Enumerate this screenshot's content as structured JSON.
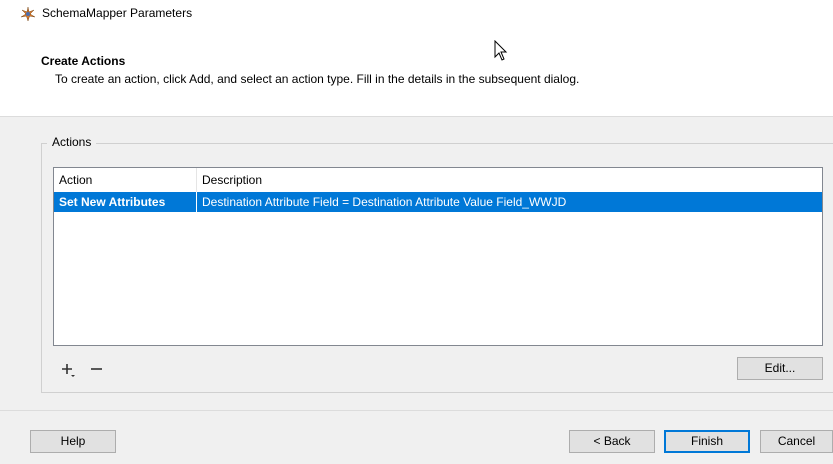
{
  "window": {
    "title": "SchemaMapper Parameters",
    "icon": "schemamapper-icon"
  },
  "header": {
    "title": "Create Actions",
    "description": "To create an action, click Add, and select an action type. Fill in the details in the subsequent dialog."
  },
  "group": {
    "label": "Actions"
  },
  "table": {
    "columns": [
      "Action",
      "Description"
    ],
    "rows": [
      {
        "action": "Set New Attributes",
        "description": "Destination Attribute Field = Destination Attribute Value Field_WWJD",
        "selected": true
      }
    ]
  },
  "toolbar": {
    "add_icon": "plus-dropdown-icon",
    "remove_icon": "minus-icon",
    "edit_label": "Edit..."
  },
  "footer": {
    "help_label": "Help",
    "back_label": "< Back",
    "finish_label": "Finish",
    "cancel_label": "Cancel"
  },
  "colors": {
    "selection": "#0078d7",
    "background": "#f0f0f0"
  }
}
